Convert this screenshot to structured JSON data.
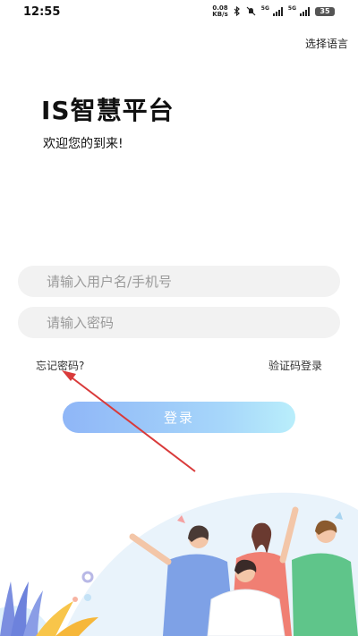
{
  "status_bar": {
    "time": "12:55",
    "net_speed_value": "0.08",
    "net_speed_unit": "KB/s",
    "sim1_label": "5G",
    "sim2_label": "5G",
    "battery": "35"
  },
  "header": {
    "language_link": "选择语言"
  },
  "brand": {
    "title": "IS智慧平台",
    "welcome": "欢迎您的到来!"
  },
  "form": {
    "username_placeholder": "请输入用户名/手机号",
    "password_placeholder": "请输入密码",
    "forgot_password": "忘记密码?",
    "sms_login": "验证码登录",
    "login_button": "登录"
  },
  "colors": {
    "login_gradient_start": "#8fb6f7",
    "login_gradient_end": "#b9eefb",
    "annotation_arrow": "#d93a3a"
  }
}
